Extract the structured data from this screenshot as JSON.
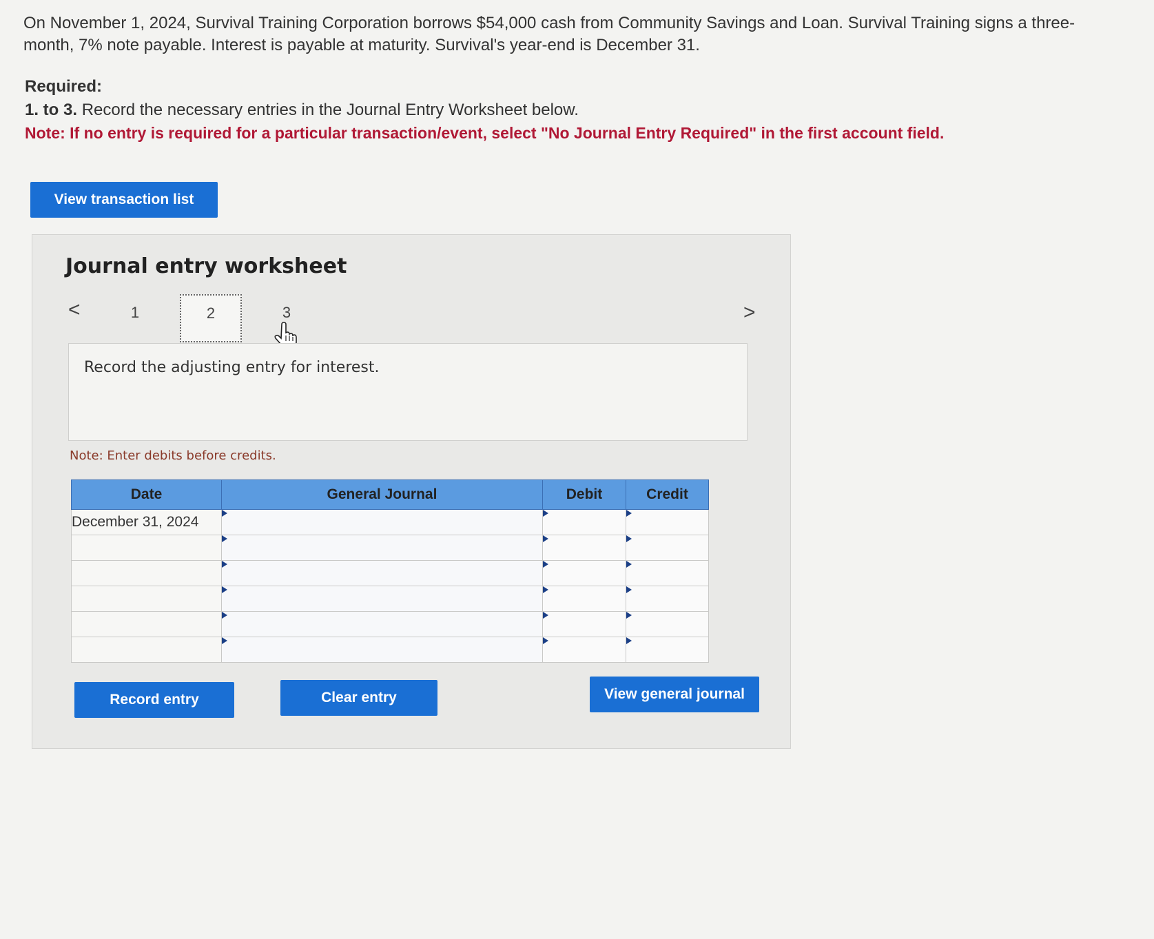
{
  "problem": {
    "text": "On November 1, 2024, Survival Training Corporation borrows $54,000 cash from Community Savings and Loan. Survival Training signs a three-month, 7% note payable. Interest is payable at maturity. Survival's year-end is December 31."
  },
  "required": {
    "heading": "Required:",
    "instruction_bold": "1. to 3.",
    "instruction_rest": " Record the necessary entries in the Journal Entry Worksheet below.",
    "note": "Note: If no entry is required for a particular transaction/event, select \"No Journal Entry Required\" in the first account field."
  },
  "buttons": {
    "view_transaction_list": "View transaction list",
    "record_entry": "Record entry",
    "clear_entry": "Clear entry",
    "view_general_journal": "View general journal"
  },
  "worksheet": {
    "title": "Journal entry worksheet",
    "prev": "<",
    "next": ">",
    "steps": [
      "1",
      "2",
      "3"
    ],
    "active_step": "2",
    "description": "Record the adjusting entry for interest.",
    "note": "Note: Enter debits before credits."
  },
  "table": {
    "headers": [
      "Date",
      "General Journal",
      "Debit",
      "Credit"
    ],
    "rows": [
      {
        "date": "December 31, 2024",
        "account": "",
        "debit": "",
        "credit": ""
      },
      {
        "date": "",
        "account": "",
        "debit": "",
        "credit": ""
      },
      {
        "date": "",
        "account": "",
        "debit": "",
        "credit": ""
      },
      {
        "date": "",
        "account": "",
        "debit": "",
        "credit": ""
      },
      {
        "date": "",
        "account": "",
        "debit": "",
        "credit": ""
      },
      {
        "date": "",
        "account": "",
        "debit": "",
        "credit": ""
      }
    ]
  },
  "colors": {
    "accent": "#1a6fd4",
    "header": "#5b9be0",
    "note_red": "#b01835"
  },
  "icons": {
    "pointer": "hand-pointer-icon"
  }
}
